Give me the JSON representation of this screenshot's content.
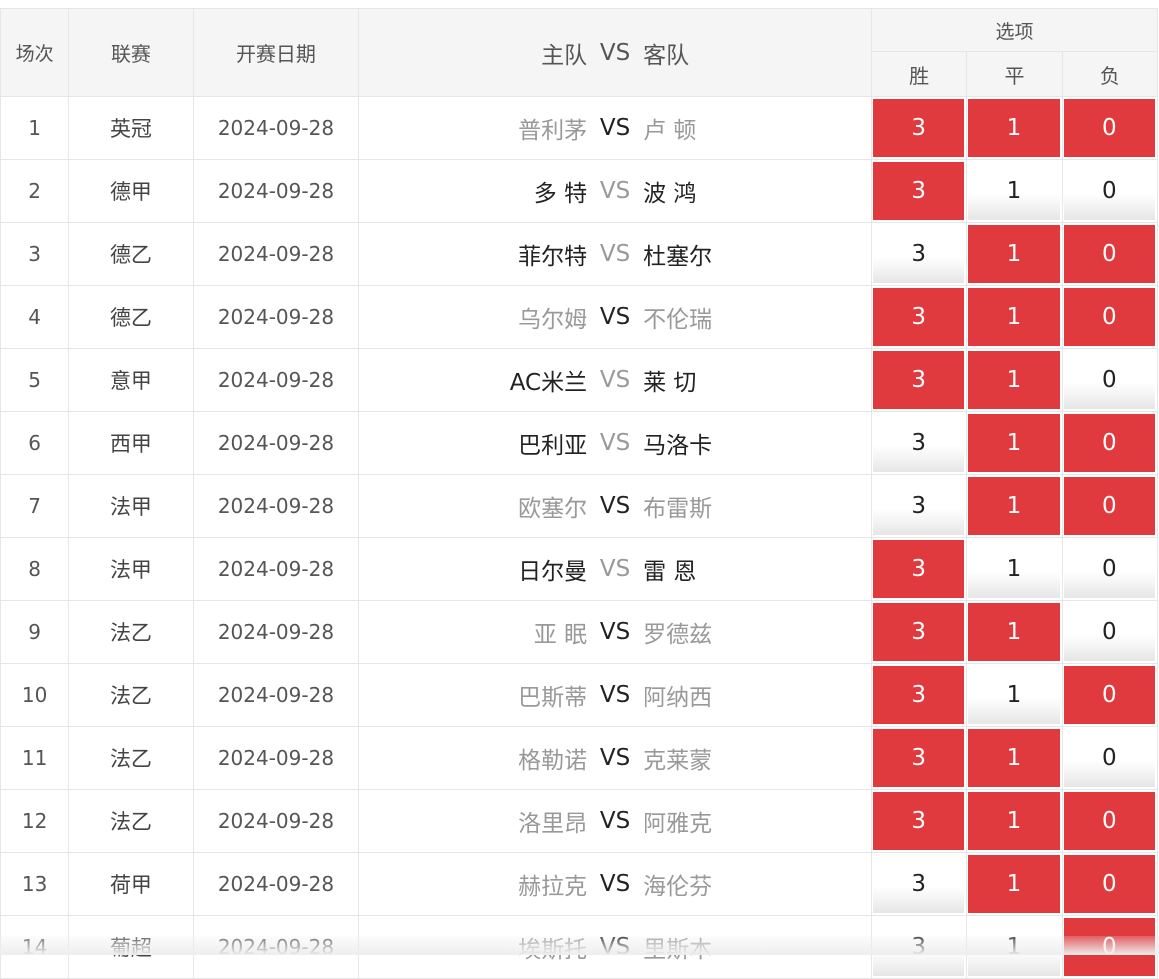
{
  "header": {
    "no": "场次",
    "league": "联赛",
    "date": "开赛日期",
    "home": "主队",
    "vs": "VS",
    "away": "客队",
    "options_title": "选项",
    "win": "胜",
    "draw": "平",
    "lose": "负"
  },
  "option_values": {
    "win": "3",
    "draw": "1",
    "lose": "0"
  },
  "colors": {
    "selected_bg": "#e0393e",
    "selected_text": "#ffffff",
    "dim_text": "#999999",
    "dark_text": "#222222"
  },
  "rows": [
    {
      "no": "1",
      "league": "英冠",
      "date": "2024-09-28",
      "home": "普利茅",
      "away": "卢 顿",
      "home_dim": true,
      "vs_dim": false,
      "away_dim": true,
      "win": true,
      "draw": true,
      "lose": true
    },
    {
      "no": "2",
      "league": "德甲",
      "date": "2024-09-28",
      "home": "多 特",
      "away": "波 鸿",
      "home_dim": false,
      "vs_dim": true,
      "away_dim": false,
      "win": true,
      "draw": false,
      "lose": false
    },
    {
      "no": "3",
      "league": "德乙",
      "date": "2024-09-28",
      "home": "菲尔特",
      "away": "杜塞尔",
      "home_dim": false,
      "vs_dim": true,
      "away_dim": false,
      "win": false,
      "draw": true,
      "lose": true
    },
    {
      "no": "4",
      "league": "德乙",
      "date": "2024-09-28",
      "home": "乌尔姆",
      "away": "不伦瑞",
      "home_dim": true,
      "vs_dim": false,
      "away_dim": true,
      "win": true,
      "draw": true,
      "lose": true
    },
    {
      "no": "5",
      "league": "意甲",
      "date": "2024-09-28",
      "home": "AC米兰",
      "away": "莱 切",
      "home_dim": false,
      "vs_dim": true,
      "away_dim": false,
      "win": true,
      "draw": true,
      "lose": false
    },
    {
      "no": "6",
      "league": "西甲",
      "date": "2024-09-28",
      "home": "巴利亚",
      "away": "马洛卡",
      "home_dim": false,
      "vs_dim": true,
      "away_dim": false,
      "win": false,
      "draw": true,
      "lose": true
    },
    {
      "no": "7",
      "league": "法甲",
      "date": "2024-09-28",
      "home": "欧塞尔",
      "away": "布雷斯",
      "home_dim": true,
      "vs_dim": false,
      "away_dim": true,
      "win": false,
      "draw": true,
      "lose": true
    },
    {
      "no": "8",
      "league": "法甲",
      "date": "2024-09-28",
      "home": "日尔曼",
      "away": "雷 恩",
      "home_dim": false,
      "vs_dim": true,
      "away_dim": false,
      "win": true,
      "draw": false,
      "lose": false
    },
    {
      "no": "9",
      "league": "法乙",
      "date": "2024-09-28",
      "home": "亚 眠",
      "away": "罗德兹",
      "home_dim": true,
      "vs_dim": false,
      "away_dim": true,
      "win": true,
      "draw": true,
      "lose": false
    },
    {
      "no": "10",
      "league": "法乙",
      "date": "2024-09-28",
      "home": "巴斯蒂",
      "away": "阿纳西",
      "home_dim": true,
      "vs_dim": false,
      "away_dim": true,
      "win": true,
      "draw": false,
      "lose": true
    },
    {
      "no": "11",
      "league": "法乙",
      "date": "2024-09-28",
      "home": "格勒诺",
      "away": "克莱蒙",
      "home_dim": true,
      "vs_dim": false,
      "away_dim": true,
      "win": true,
      "draw": true,
      "lose": false
    },
    {
      "no": "12",
      "league": "法乙",
      "date": "2024-09-28",
      "home": "洛里昂",
      "away": "阿雅克",
      "home_dim": true,
      "vs_dim": false,
      "away_dim": true,
      "win": true,
      "draw": true,
      "lose": true
    },
    {
      "no": "13",
      "league": "荷甲",
      "date": "2024-09-28",
      "home": "赫拉克",
      "away": "海伦芬",
      "home_dim": true,
      "vs_dim": false,
      "away_dim": true,
      "win": false,
      "draw": true,
      "lose": true
    },
    {
      "no": "14",
      "league": "葡超",
      "date": "2024-09-28",
      "home": "埃斯托",
      "away": "里斯本",
      "home_dim": true,
      "vs_dim": false,
      "away_dim": true,
      "win": false,
      "draw": false,
      "lose": true
    }
  ]
}
